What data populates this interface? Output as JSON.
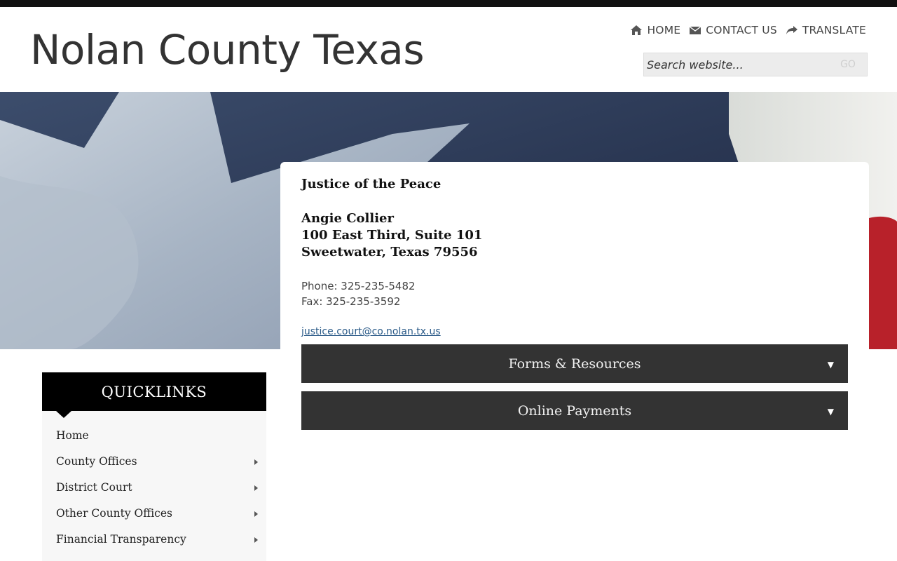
{
  "site": {
    "title": "Nolan County Texas"
  },
  "topnav": [
    {
      "label": "HOME",
      "icon": "home-icon"
    },
    {
      "label": "CONTACT US",
      "icon": "envelope-icon"
    },
    {
      "label": "TRANSLATE",
      "icon": "share-icon"
    }
  ],
  "search": {
    "placeholder": "Search website...",
    "button_label": "GO"
  },
  "content": {
    "title": "Justice of the Peace",
    "name": "Angie Collier",
    "address_line1": "100 East Third, Suite 101",
    "address_line2": "Sweetwater, Texas 79556",
    "phone": "Phone: 325-235-5482",
    "fax": "Fax: 325-235-3592",
    "email": "justice.court@co.nolan.tx.us",
    "accordions": [
      {
        "label": "Forms & Resources",
        "arrow": "▼"
      },
      {
        "label": "Online Payments",
        "arrow": "▼"
      }
    ]
  },
  "quicklinks": {
    "heading": "QUICKLINKS",
    "items": [
      {
        "label": "Home",
        "has_submenu": false
      },
      {
        "label": "County Offices",
        "has_submenu": true
      },
      {
        "label": "District Court",
        "has_submenu": true
      },
      {
        "label": "Other County Offices",
        "has_submenu": true
      },
      {
        "label": "Financial Transparency",
        "has_submenu": true
      }
    ]
  },
  "colors": {
    "accordion_bg": "#333333",
    "link": "#2a5a88",
    "quicklinks_head": "#000000"
  }
}
